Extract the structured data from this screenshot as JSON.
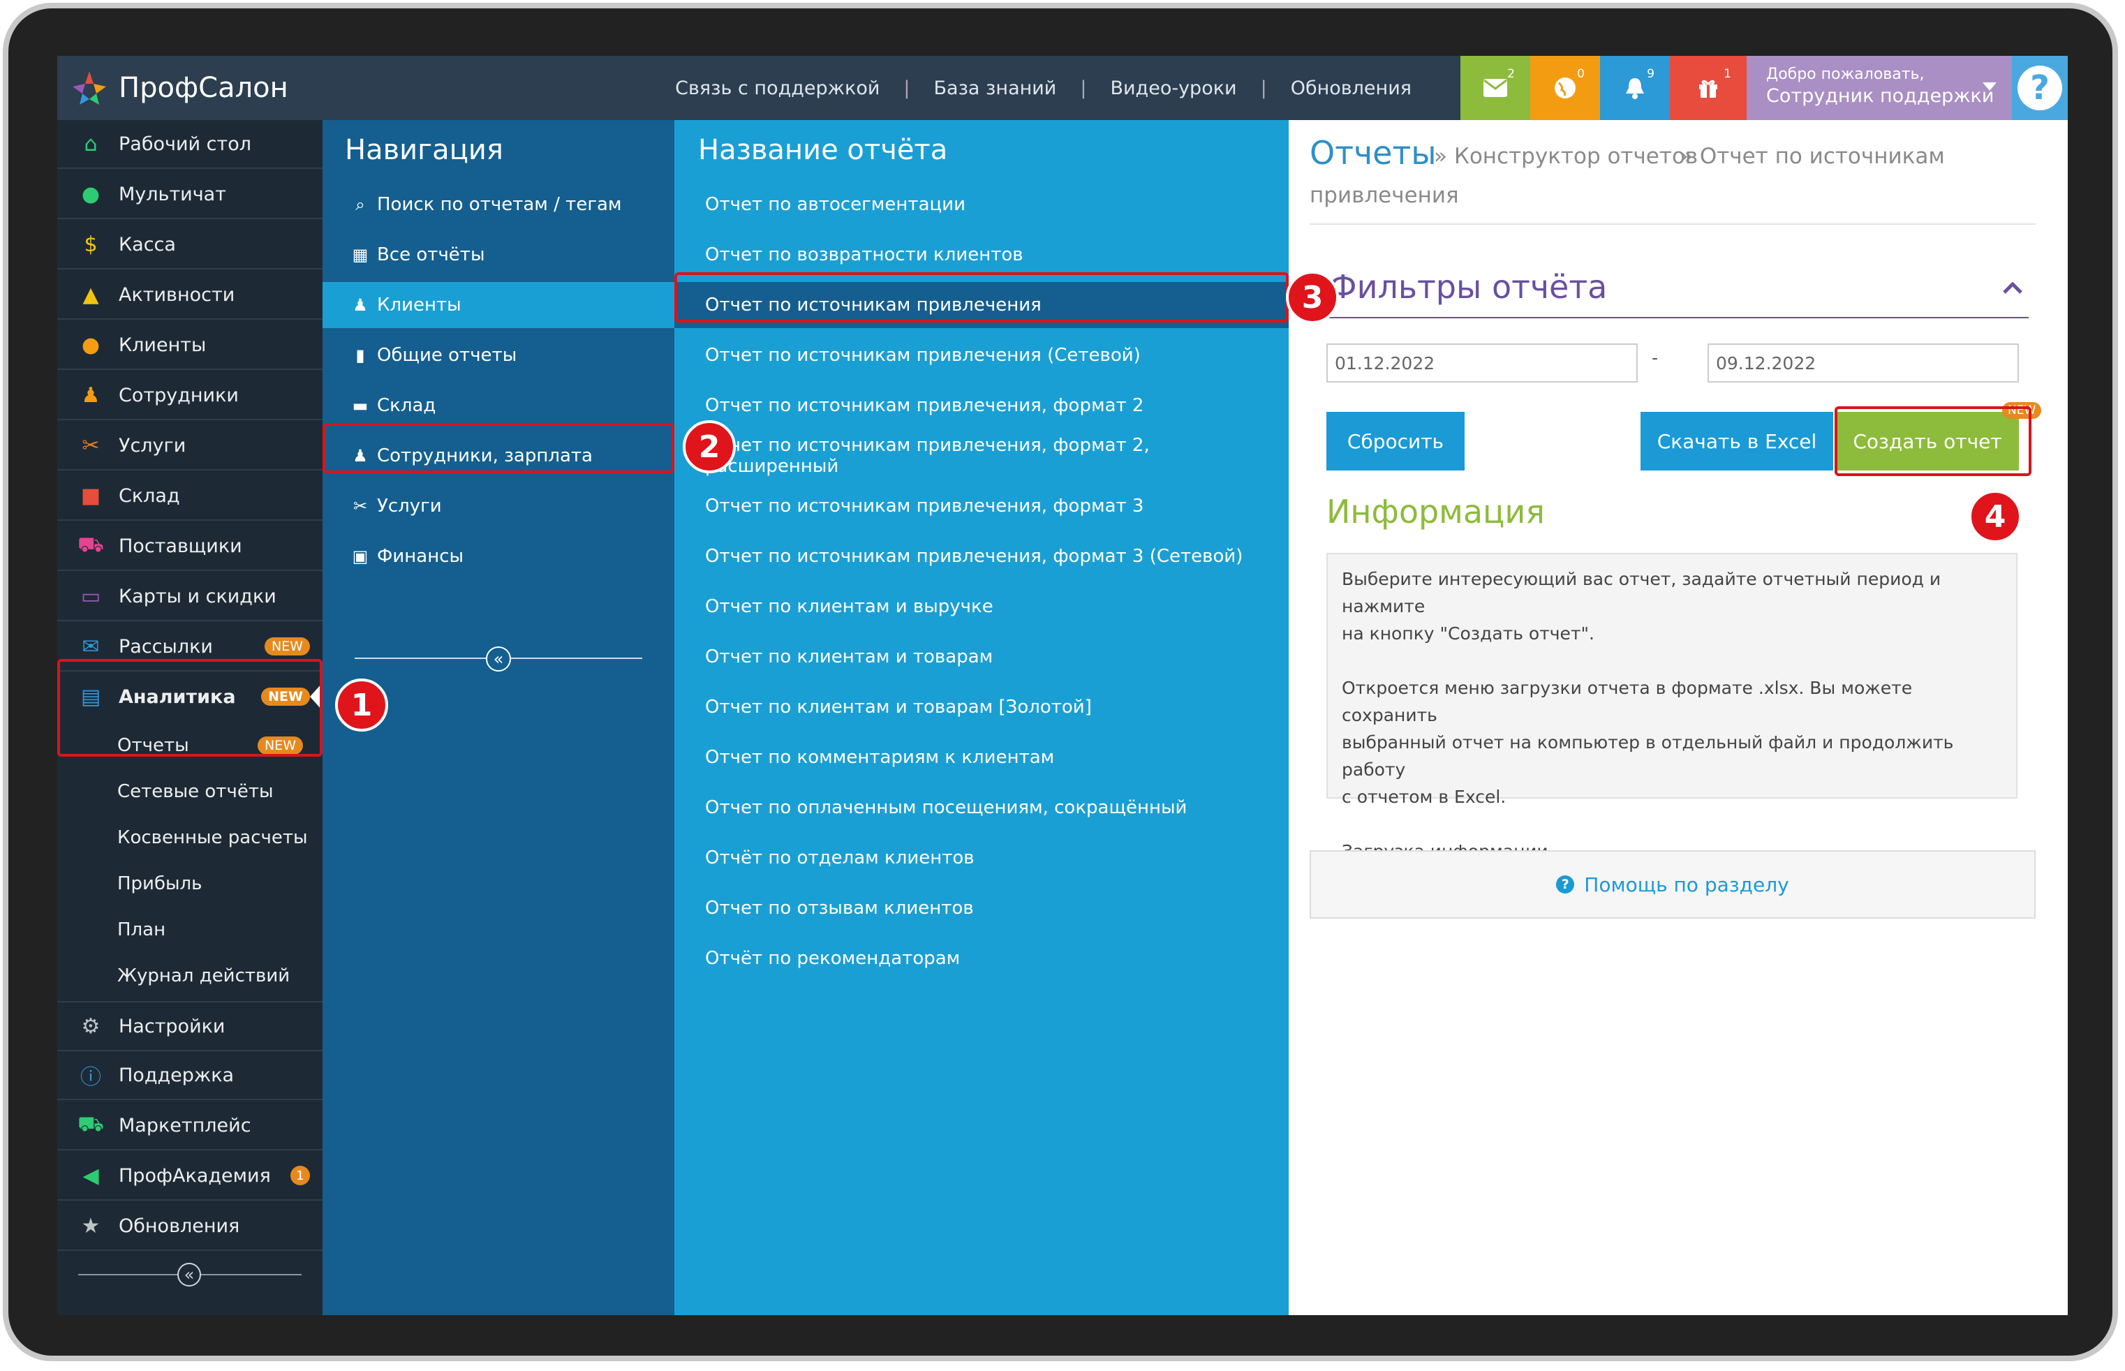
{
  "app": {
    "logo_text": "ПрофСалон"
  },
  "header": {
    "links": [
      "Связь с поддержкой",
      "База знаний",
      "Видео-уроки",
      "Обновления"
    ],
    "counters": {
      "mail": "2",
      "globe": "0",
      "bell": "9",
      "gift": "1"
    },
    "welcome_line1": "Добро пожаловать,",
    "welcome_line2": "Сотрудник поддержки",
    "tile_colors": {
      "mail": "#8dbb3b",
      "globe": "#f39c12",
      "bell": "#2b9ad6",
      "gift": "#e74c3c"
    }
  },
  "sidebar": {
    "items": [
      {
        "label": "Рабочий стол",
        "icon": "home-icon",
        "color": "#2ecc71"
      },
      {
        "label": "Мультичат",
        "icon": "chat-icon",
        "color": "#2ecc71"
      },
      {
        "label": "Касса",
        "icon": "dollar-icon",
        "color": "#f1c40f"
      },
      {
        "label": "Активности",
        "icon": "bell-icon",
        "color": "#f1c40f"
      },
      {
        "label": "Клиенты",
        "icon": "users-icon",
        "color": "#f39c12"
      },
      {
        "label": "Сотрудники",
        "icon": "person-icon",
        "color": "#f39c12"
      },
      {
        "label": "Услуги",
        "icon": "scissors-icon",
        "color": "#e67e22"
      },
      {
        "label": "Склад",
        "icon": "box-icon",
        "color": "#e74c3c"
      },
      {
        "label": "Поставщики",
        "icon": "cart-icon",
        "color": "#e84393"
      },
      {
        "label": "Карты и скидки",
        "icon": "card-icon",
        "color": "#9b59b6"
      },
      {
        "label": "Рассылки",
        "icon": "envelope-icon",
        "color": "#3498db",
        "badge": "NEW"
      },
      {
        "label": "Аналитика",
        "icon": "document-icon",
        "color": "#3498db",
        "badge": "NEW"
      }
    ],
    "sub_items": [
      {
        "label": "Отчеты",
        "badge": "NEW"
      },
      {
        "label": "Сетевые отчёты"
      },
      {
        "label": "Косвенные расчеты"
      },
      {
        "label": "Прибыль"
      },
      {
        "label": "План"
      },
      {
        "label": "Журнал действий"
      }
    ],
    "bottom_items": [
      {
        "label": "Настройки",
        "icon": "gears-icon",
        "color": "#bdc3c7"
      },
      {
        "label": "Поддержка",
        "icon": "info-icon",
        "color": "#3498db"
      },
      {
        "label": "Маркетплейс",
        "icon": "cart-icon",
        "color": "#2ecc71"
      },
      {
        "label": "ПрофАкадемия",
        "icon": "megaphone-icon",
        "color": "#2ecc71",
        "count": "1"
      },
      {
        "label": "Обновления",
        "icon": "star-icon",
        "color": "#bdc3c7"
      }
    ]
  },
  "navigation": {
    "title": "Навигация",
    "items": [
      {
        "label": "Поиск по отчетам / тегам",
        "icon": "search-icon"
      },
      {
        "label": "Все отчёты",
        "icon": "grid-icon"
      },
      {
        "label": "Клиенты",
        "icon": "person-icon",
        "active": true
      },
      {
        "label": "Общие отчеты",
        "icon": "file-icon"
      },
      {
        "label": "Склад",
        "icon": "archive-icon"
      },
      {
        "label": "Сотрудники, зарплата",
        "icon": "person-icon"
      },
      {
        "label": "Услуги",
        "icon": "scissors-icon"
      },
      {
        "label": "Финансы",
        "icon": "money-icon"
      }
    ]
  },
  "reports": {
    "title": "Название отчёта",
    "items": [
      "Отчет по автосегментации",
      "Отчет по возвратности клиентов",
      "Отчет по источникам привлечения",
      "Отчет по источникам привлечения (Сетевой)",
      "Отчет по источникам привлечения, формат 2",
      "Отчет по источникам привлечения, формат 2, расширенный",
      "Отчет по источникам привлечения, формат 3",
      "Отчет по источникам привлечения, формат 3 (Сетевой)",
      "Отчет по клиентам и выручке",
      "Отчет по клиентам и товарам",
      "Отчет по клиентам и товарам [Золотой]",
      "Отчет по комментариям к клиентам",
      "Отчет по оплаченным посещениям, сокращённый",
      "Отчёт по отделам клиентов",
      "Отчет по отзывам клиентов",
      "Отчёт по рекомендаторам"
    ],
    "selected_index": 2
  },
  "main": {
    "title": "Отчеты",
    "breadcrumb_1": "» Конструктор отчетов",
    "breadcrumb_2": "» Отчет по источникам",
    "breadcrumb_3": "привлечения",
    "filters_title": "Фильтры отчёта",
    "date_from": "01.12.2022",
    "date_sep": "-",
    "date_to": "09.12.2022",
    "reset_label": "Сбросить",
    "excel_label": "Скачать в Excel",
    "create_label": "Создать отчет",
    "create_badge": "NEW",
    "info_title": "Информация",
    "info_p1_l1": "Выберите интересующий вас отчет, задайте отчетный период и нажмите",
    "info_p1_l2": "на кнопку \"Создать отчет\".",
    "info_p2_l1": "Откроется меню загрузки отчета в формате .xlsx. Вы можете сохранить",
    "info_p2_l2": "выбранный отчет на компьютер в отдельный файл и продолжить работу",
    "info_p2_l3": "с отчетом в Excel.",
    "info_p3": "Загрузка информации...",
    "help_label": "Помощь по разделу"
  },
  "callouts": [
    "1",
    "2",
    "3",
    "4"
  ]
}
